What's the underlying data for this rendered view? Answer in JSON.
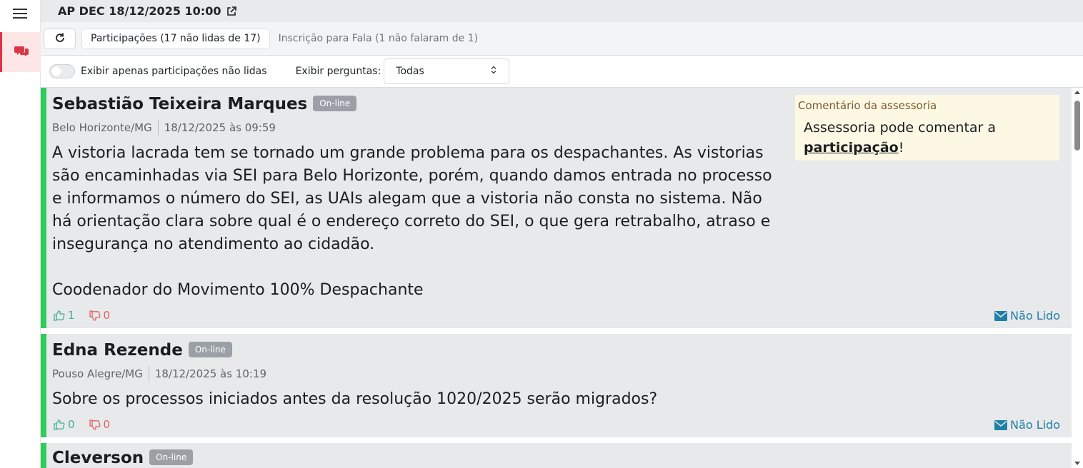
{
  "header": {
    "title": "AP DEC 18/12/2025 10:00",
    "external_icon": "external-link-icon"
  },
  "rail": {
    "menu_icon": "hamburger-menu-icon",
    "active_item_icon": "comments-icon",
    "accent_color": "#dc3545"
  },
  "tabs": {
    "refresh_icon": "refresh-icon",
    "items": [
      {
        "label": "Participações (17 não lidas de 17)",
        "active": true
      },
      {
        "label": "Inscrição para Fala (1 não falaram de 1)",
        "active": false
      }
    ]
  },
  "filters": {
    "unread_only_label": "Exibir apenas participações não lidas",
    "unread_only_checked": false,
    "questions_label": "Exibir perguntas:",
    "questions_value": "Todas"
  },
  "participations": [
    {
      "name": "Sebastião Teixeira Marques",
      "badge": "On-line",
      "city": "Belo Horizonte/MG",
      "datetime": "18/12/2025 às 09:59",
      "text": "A vistoria lacrada tem se tornado um grande problema para os despachantes. As vistorias são encaminhadas via SEI para Belo Horizonte, porém, quando damos entrada no processo e informamos o número do SEI, as UAIs alegam que a vistoria não consta no sistema. Não há orientação clara sobre qual é o endereço correto do SEI, o que gera retrabalho, atraso e insegurança no atendimento ao cidadão.\n\nCoodenador do Movimento 100% Despachante",
      "likes": "1",
      "dislikes": "0",
      "status": "Não Lido",
      "comment_title": "Comentário da assessoria",
      "comment_text": "Assessoria pode comentar a",
      "comment_link": "participação",
      "comment_end": "!"
    },
    {
      "name": "Edna Rezende",
      "badge": "On-line",
      "city": "Pouso Alegre/MG",
      "datetime": "18/12/2025 às 10:19",
      "text": "Sobre os processos iniciados antes da resolução 1020/2025 serão migrados?",
      "likes": "0",
      "dislikes": "0",
      "status": "Não Lido"
    },
    {
      "name": "Cleverson",
      "badge": "On-line"
    }
  ],
  "colors": {
    "card_border": "#2ecc5a",
    "card_bg": "#e8e9eb",
    "link": "#1f7fa6",
    "like": "#3eb28a",
    "dislike": "#e06060"
  }
}
